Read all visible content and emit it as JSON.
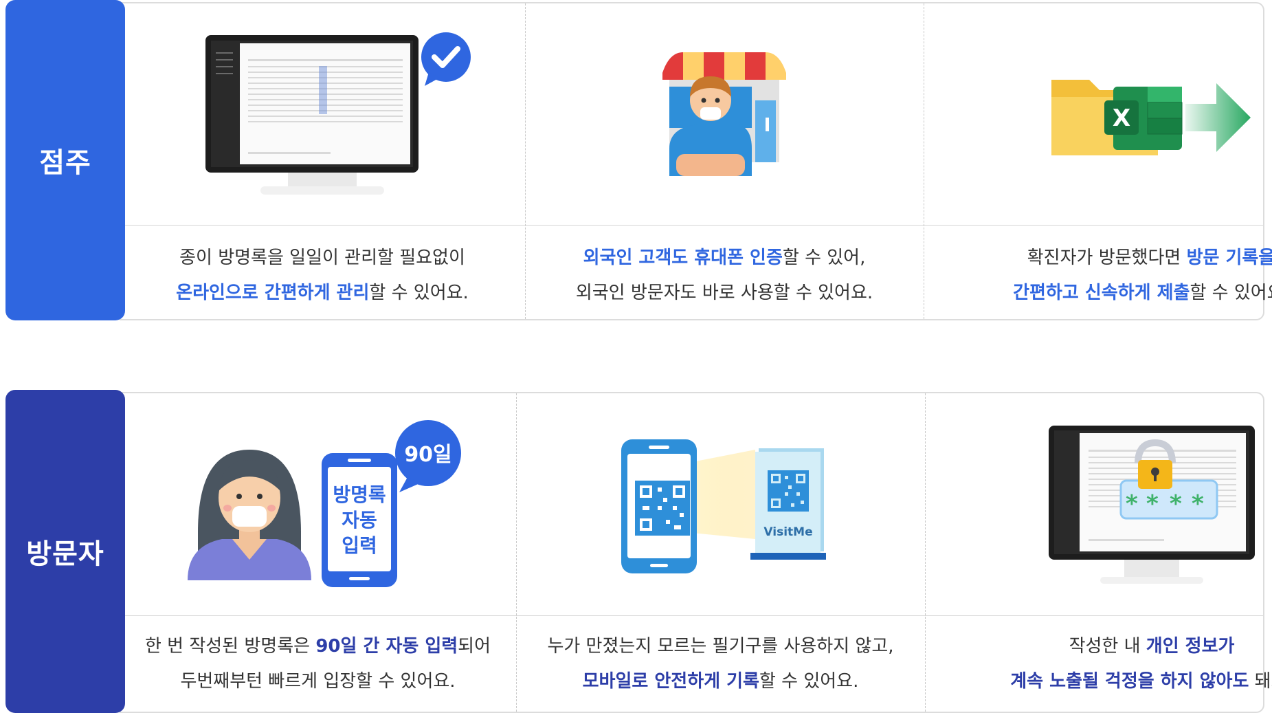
{
  "owner": {
    "label": "점주",
    "cards": [
      {
        "line1_a": "종이 방명록을 일일이 관리할 필요없이",
        "line2_hl": "온라인으로 간편하게 관리",
        "line2_b": "할 수 있어요."
      },
      {
        "line1_hl": "외국인 고객도 휴대폰 인증",
        "line1_b": "할 수 있어,",
        "line2_a": "외국인 방문자도 바로 사용할 수 있어요."
      },
      {
        "line1_a": "확진자가 방문했다면 ",
        "line1_hl": "방문 기록을",
        "line2_hl": "간편하고 신속하게 제출",
        "line2_b": "할 수 있어요."
      }
    ]
  },
  "visitor": {
    "label": "방문자",
    "phone_text": [
      "방명록",
      "자동",
      "입력"
    ],
    "badge_90": "90일",
    "visitme": "VisitMe",
    "cards": [
      {
        "line1_a": "한 번 작성된 방명록은 ",
        "line1_hl": "90일 간 자동 입력",
        "line1_b": "되어",
        "line2_a": "두번째부턴 빠르게 입장할 수 있어요."
      },
      {
        "line1_a": "누가 만졌는지 모르는 필기구를 사용하지 않고,",
        "line2_hl": "모바일로 안전하게 기록",
        "line2_b": "할 수 있어요."
      },
      {
        "line1_a": "작성한 내 ",
        "line1_hl": "개인 정보가",
        "line2_hl": "계속 노출될 걱정을 하지 않아도",
        "line2_b": " 돼요."
      }
    ]
  },
  "colors": {
    "owner_blue": "#2f66e0",
    "visitor_navy": "#2d3ea8"
  },
  "icons": [
    "check-bubble-icon",
    "store-owner-icon",
    "folder-excel-export-icon",
    "woman-mask-icon",
    "phone-qr-scan-icon",
    "monitor-lock-icon"
  ]
}
